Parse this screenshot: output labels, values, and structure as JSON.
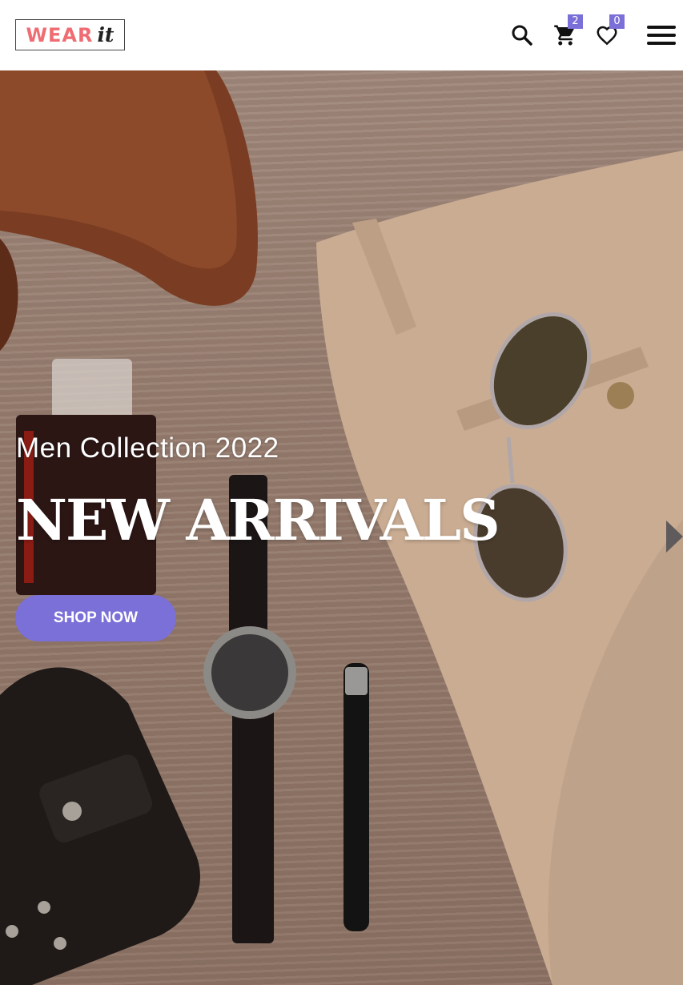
{
  "header": {
    "logo": {
      "word": "WEAR",
      "accent": "it"
    },
    "search_icon": "search-icon",
    "cart": {
      "icon": "cart-icon",
      "count": "2"
    },
    "wishlist": {
      "icon": "heart-icon",
      "count": "0"
    },
    "menu_icon": "hamburger-menu-icon"
  },
  "hero": {
    "subtitle": "Men Collection 2022",
    "title": "NEW ARRIVALS",
    "cta": "SHOP NOW",
    "next_icon": "next-arrow-icon"
  },
  "colors": {
    "accent": "#7b6fd8",
    "logo_pink": "#ef6c73"
  }
}
